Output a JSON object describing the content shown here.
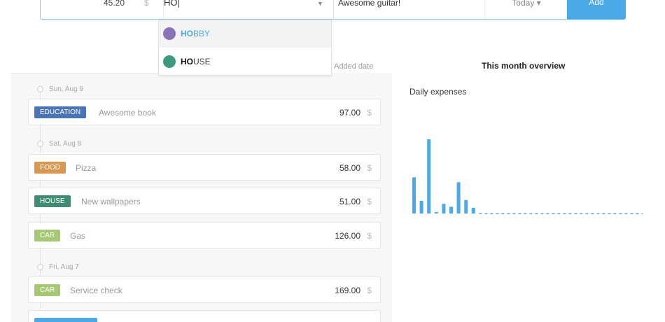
{
  "entry": {
    "amount": "45.20",
    "currency": "$",
    "category_value": "HO",
    "description_value": "Awesome guitar!",
    "date_label": "Today ▾",
    "add_label": "Add"
  },
  "dropdown": {
    "items": [
      {
        "match": "HO",
        "rest": "BBY",
        "color": "#8a73b8",
        "highlighted": true
      },
      {
        "match": "HO",
        "rest": "USE",
        "color": "#3e9a7e",
        "highlighted": false
      }
    ]
  },
  "list": {
    "added_date_header": "Added date",
    "groups": [
      {
        "date": "Sun, Aug 9",
        "expenses": [
          {
            "category": "EDUCATION",
            "color": "#4a74b5",
            "description": "Awesome book",
            "amount": "97.00",
            "currency": "$"
          }
        ]
      },
      {
        "date": "Sat, Aug 8",
        "expenses": [
          {
            "category": "FOOD",
            "color": "#d9984f",
            "description": "Pizza",
            "amount": "58.00",
            "currency": "$"
          },
          {
            "category": "HOUSE",
            "color": "#3e8c73",
            "description": "New wallpapers",
            "amount": "51.00",
            "currency": "$"
          },
          {
            "category": "CAR",
            "color": "#a7c872",
            "description": "Gas",
            "amount": "126.00",
            "currency": "$"
          }
        ]
      },
      {
        "date": "Fri, Aug 7",
        "expenses": [
          {
            "category": "CAR",
            "color": "#a7c872",
            "description": "Service check",
            "amount": "169.00",
            "currency": "$"
          }
        ]
      }
    ]
  },
  "overview": {
    "title": "This month overview",
    "daily_title": "Daily expenses"
  },
  "chart_data": {
    "type": "bar",
    "title": "Daily expenses",
    "color": "#4aa9e6",
    "values": [
      97,
      34,
      199,
      4,
      26,
      18,
      84,
      36,
      15
    ]
  }
}
